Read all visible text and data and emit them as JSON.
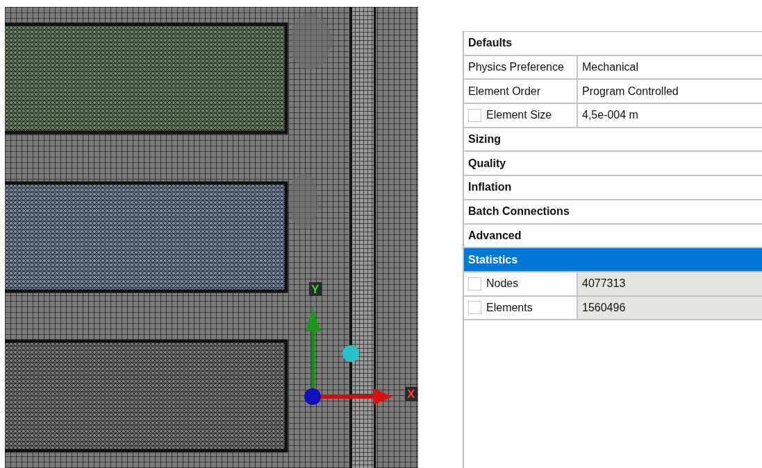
{
  "viewport": {
    "axes": [
      {
        "kind": "y",
        "label": "Y"
      },
      {
        "kind": "x",
        "label": "X"
      }
    ]
  },
  "details": {
    "rows": [
      {
        "kind": "group",
        "label": "Defaults",
        "selected": false
      },
      {
        "kind": "property",
        "label": "Physics Preference",
        "value": "Mechanical",
        "selected": false
      },
      {
        "kind": "property",
        "label": "Element Order",
        "value": "Program Controlled",
        "selected": false
      },
      {
        "kind": "property",
        "label": "Element Size",
        "value": "4,5e-004 m",
        "checked": false,
        "selected": false
      },
      {
        "kind": "group",
        "label": "Sizing",
        "selected": false
      },
      {
        "kind": "group",
        "label": "Quality",
        "selected": false
      },
      {
        "kind": "group",
        "label": "Inflation",
        "selected": false
      },
      {
        "kind": "group",
        "label": "Batch Connections",
        "selected": false
      },
      {
        "kind": "group",
        "label": "Advanced",
        "selected": false
      },
      {
        "kind": "group",
        "label": "Statistics",
        "selected": true
      },
      {
        "kind": "property",
        "label": "Nodes",
        "value": "4077313",
        "checked": false,
        "readonly": true,
        "selected": false
      },
      {
        "kind": "property",
        "label": "Elements",
        "value": "1560496",
        "checked": false,
        "readonly": true,
        "selected": false
      }
    ]
  }
}
